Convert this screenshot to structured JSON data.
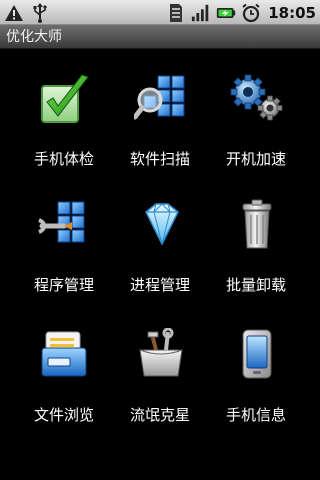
{
  "status_bar": {
    "icons_left": [
      "warning-icon",
      "usb-icon"
    ],
    "icons_right": [
      "sim-card-icon",
      "signal-bars-icon",
      "battery-charging-icon",
      "alarm-clock-icon"
    ],
    "time": "18:05"
  },
  "app": {
    "title": "优化大师"
  },
  "grid": {
    "items": [
      {
        "label": "手机体检",
        "icon": "checkmark-icon"
      },
      {
        "label": "软件扫描",
        "icon": "magnifier-blocks-icon"
      },
      {
        "label": "开机加速",
        "icon": "gears-icon"
      },
      {
        "label": "程序管理",
        "icon": "program-manager-icon"
      },
      {
        "label": "进程管理",
        "icon": "diamond-icon"
      },
      {
        "label": "批量卸载",
        "icon": "trash-can-icon"
      },
      {
        "label": "文件浏览",
        "icon": "file-folder-icon"
      },
      {
        "label": "流氓克星",
        "icon": "toolbox-icon"
      },
      {
        "label": "手机信息",
        "icon": "phone-info-icon"
      }
    ]
  },
  "colors": {
    "background": "#000000",
    "title_bar": "#4a4a4a",
    "status_bar": "#d0d0d0",
    "accent_blue": "#2b8fe0",
    "accent_green": "#2fa62a"
  }
}
